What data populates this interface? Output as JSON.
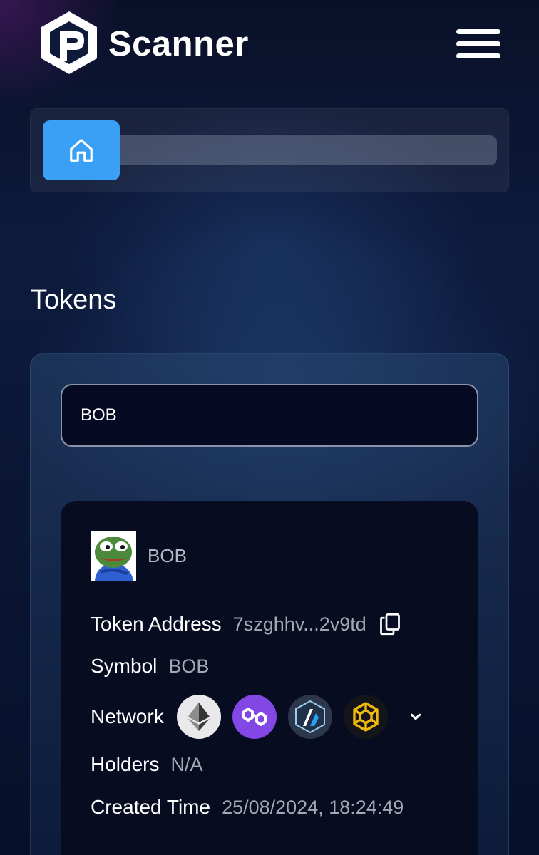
{
  "header": {
    "brand": "Scanner",
    "logo_icon": "scanner-logo-icon",
    "menu_icon": "hamburger-menu-icon"
  },
  "breadcrumb": {
    "home_icon": "home-icon",
    "home_color": "#3aa0f5"
  },
  "page": {
    "title": "Tokens"
  },
  "search": {
    "value": "BOB",
    "placeholder": ""
  },
  "token": {
    "name": "BOB",
    "avatar_icon": "pepe-frog-avatar",
    "fields": {
      "address_label": "Token Address",
      "address_value": "7szghhv...2v9td",
      "symbol_label": "Symbol",
      "symbol_value": "BOB",
      "network_label": "Network",
      "holders_label": "Holders",
      "holders_value": "N/A",
      "created_label": "Created Time",
      "created_value": "25/08/2024, 18:24:49"
    },
    "networks": [
      {
        "icon": "ethereum-icon",
        "color": "#e9e9ec"
      },
      {
        "icon": "polygon-icon",
        "color": "#8247e5"
      },
      {
        "icon": "arbitrum-icon",
        "color": "#2d374b"
      },
      {
        "icon": "bnb-chain-icon",
        "color": "#f0b90b"
      }
    ]
  }
}
